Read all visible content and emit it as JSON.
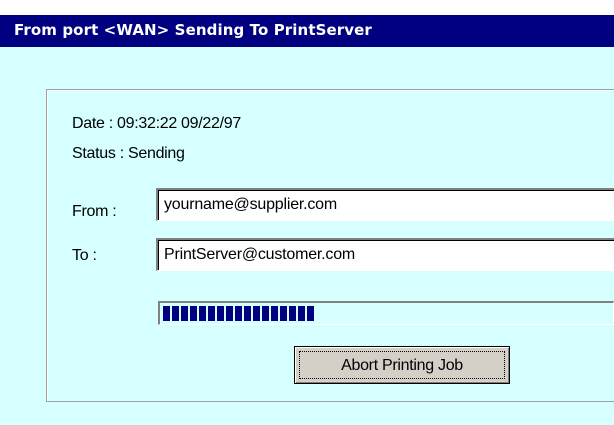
{
  "window": {
    "title": "From port <WAN> Sending To PrintServer"
  },
  "details": {
    "date": "Date : 09:32:22 09/22/97",
    "status": "Status : Sending"
  },
  "form": {
    "from_label": "From :",
    "from_value": "yourname@supplier.com",
    "to_label": "To :",
    "to_value": "PrintServer@customer.com"
  },
  "progress": {
    "fraction": 0.33
  },
  "actions": {
    "abort_label": "Abort Printing Job"
  },
  "colors": {
    "title_bar": "#000080",
    "background": "#d6ffff",
    "progress_fill": "#000080"
  }
}
